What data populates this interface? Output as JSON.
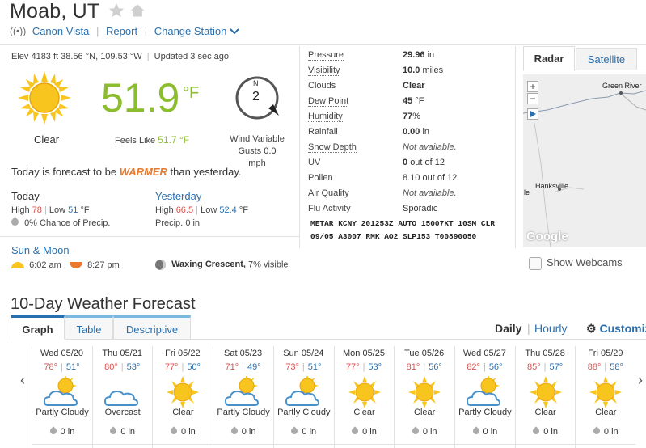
{
  "header": {
    "title": "Moab, UT",
    "station_name": "Canon Vista",
    "report_label": "Report",
    "change_station_label": "Change Station"
  },
  "current": {
    "elevation_line": "Elev 4183 ft 38.56 °N, 109.53 °W",
    "updated": "Updated 3 sec ago",
    "temperature": "51.9",
    "unit": "°F",
    "condition": "Clear",
    "feels_like_label": "Feels Like",
    "feels_like_value": "51.7 °F",
    "wind_dir": "N",
    "wind_speed": "2",
    "wind_label": "Wind Variable",
    "gusts_label": "Gusts",
    "gusts_value": "0.0",
    "gusts_unit": "mph",
    "forecast_prefix": "Today is forecast to be",
    "forecast_word": "WARMER",
    "forecast_suffix": "than yesterday."
  },
  "today": {
    "heading": "Today",
    "high_label": "High",
    "high": "78",
    "low_label": "Low",
    "low": "51",
    "unit": "°F",
    "precip": "0% Chance of Precip."
  },
  "yesterday": {
    "heading": "Yesterday",
    "high_label": "High",
    "high": "66.5",
    "low_label": "Low",
    "low": "52.4",
    "unit": "°F",
    "precip_label": "Precip.",
    "precip_value": "0 in"
  },
  "sun_moon": {
    "heading": "Sun & Moon",
    "sunrise": "6:02 am",
    "sunset": "8:27 pm",
    "moon_phase": "Waxing Crescent,",
    "moon_visible": "7% visible"
  },
  "details": [
    {
      "label": "Pressure",
      "value": "29.96",
      "unit": "in"
    },
    {
      "label": "Visibility",
      "value": "10.0",
      "unit": "miles"
    },
    {
      "label": "Clouds",
      "value": "Clear",
      "unit": ""
    },
    {
      "label": "Dew Point",
      "value": "45",
      "unit": "°F"
    },
    {
      "label": "Humidity",
      "value": "77",
      "unit": "%"
    },
    {
      "label": "Rainfall",
      "value": "0.00",
      "unit": "in"
    },
    {
      "label": "Snow Depth",
      "value": "Not available.",
      "unit": ""
    },
    {
      "label": "UV",
      "value": "0",
      "unit": "out of 12"
    },
    {
      "label": "Pollen",
      "value": "8.10",
      "unit": "out of 12"
    },
    {
      "label": "Air Quality",
      "value": "Not available.",
      "unit": ""
    },
    {
      "label": "Flu Activity",
      "value": "Sporadic",
      "unit": ""
    }
  ],
  "metar_line1": "METAR KCNY 201253Z AUTO 15007KT 10SM CLR",
  "metar_line2": "09/05 A3007 RMK AO2 SLP153 T00890050",
  "map": {
    "tab_radar": "Radar",
    "tab_satellite": "Satellite",
    "place1": "Green River",
    "place2": "Hanksville",
    "place3": "le",
    "zoom_in": "+",
    "zoom_out": "−",
    "brand": "Google",
    "webcams_label": "Show Webcams"
  },
  "forecast10": {
    "heading": "10-Day Weather Forecast",
    "tabs": [
      "Graph",
      "Table",
      "Descriptive"
    ],
    "daily_label": "Daily",
    "hourly_label": "Hourly",
    "customize_label": "Customiz",
    "days": [
      {
        "name": "Wed 05/20",
        "hi": "78°",
        "lo": "51°",
        "cond": "Partly Cloudy",
        "icon": "partly-cloudy",
        "precip": "0 in"
      },
      {
        "name": "Thu 05/21",
        "hi": "80°",
        "lo": "53°",
        "cond": "Overcast",
        "icon": "overcast",
        "precip": "0 in"
      },
      {
        "name": "Fri 05/22",
        "hi": "77°",
        "lo": "50°",
        "cond": "Clear",
        "icon": "clear",
        "precip": "0 in"
      },
      {
        "name": "Sat 05/23",
        "hi": "71°",
        "lo": "49°",
        "cond": "Partly Cloudy",
        "icon": "partly-cloudy",
        "precip": "0 in"
      },
      {
        "name": "Sun 05/24",
        "hi": "73°",
        "lo": "51°",
        "cond": "Partly Cloudy",
        "icon": "partly-cloudy",
        "precip": "0 in"
      },
      {
        "name": "Mon 05/25",
        "hi": "77°",
        "lo": "53°",
        "cond": "Clear",
        "icon": "clear",
        "precip": "0 in"
      },
      {
        "name": "Tue 05/26",
        "hi": "81°",
        "lo": "56°",
        "cond": "Clear",
        "icon": "clear",
        "precip": "0 in"
      },
      {
        "name": "Wed 05/27",
        "hi": "82°",
        "lo": "56°",
        "cond": "Partly Cloudy",
        "icon": "partly-cloudy",
        "precip": "0 in"
      },
      {
        "name": "Thu 05/28",
        "hi": "85°",
        "lo": "57°",
        "cond": "Clear",
        "icon": "clear",
        "precip": "0 in"
      },
      {
        "name": "Fri 05/29",
        "hi": "88°",
        "lo": "58°",
        "cond": "Clear",
        "icon": "clear",
        "precip": "0 in"
      }
    ]
  },
  "colors": {
    "accent_blue": "#2a6fad",
    "temp_green": "#8cbd2e",
    "high_red": "#d9534f",
    "warmer_orange": "#e8792f",
    "sun_yellow": "#f7c51e"
  }
}
